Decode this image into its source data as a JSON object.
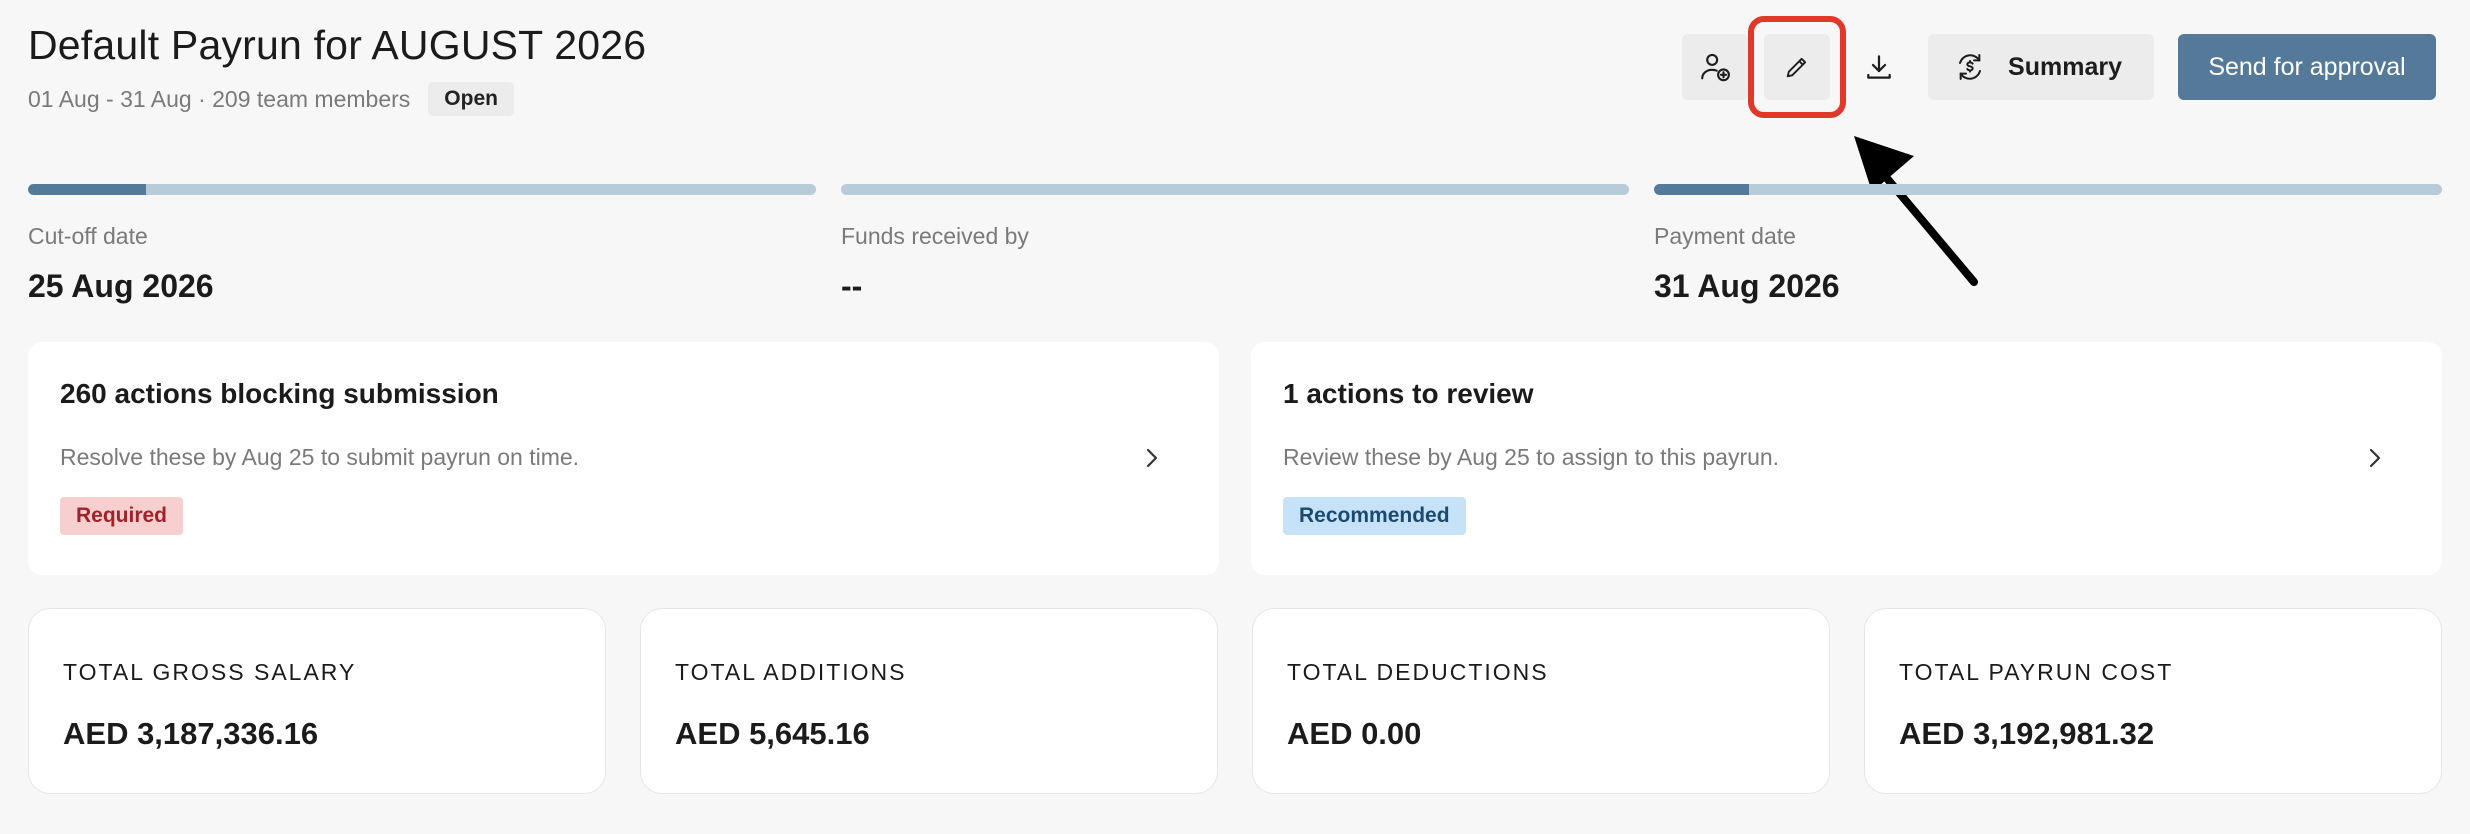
{
  "header": {
    "title": "Default Payrun for AUGUST 2026",
    "subtitle": "01 Aug - 31 Aug · 209 team members",
    "status": "Open"
  },
  "toolbar": {
    "add_member_icon": "user-add-icon",
    "edit_icon": "pencil-icon",
    "download_icon": "download-icon",
    "summary_label": "Summary",
    "summary_icon": "refresh-dollar-icon",
    "approval_label": "Send for approval"
  },
  "timeline": [
    {
      "label": "Cut-off date",
      "value": "25 Aug 2026",
      "progress": 0.15
    },
    {
      "label": "Funds received by",
      "value": "--",
      "progress": 0
    },
    {
      "label": "Payment date",
      "value": "31 Aug 2026",
      "progress": 0.12
    }
  ],
  "actions": [
    {
      "title": "260 actions blocking submission",
      "description": "Resolve these by Aug 25 to submit payrun on time.",
      "tag": "Required"
    },
    {
      "title": "1 actions to review",
      "description": "Review these by Aug 25 to assign to this payrun.",
      "tag": "Recommended"
    }
  ],
  "totals": [
    {
      "label": "TOTAL GROSS SALARY",
      "value": "AED 3,187,336.16"
    },
    {
      "label": "TOTAL ADDITIONS",
      "value": "AED 5,645.16"
    },
    {
      "label": "TOTAL DEDUCTIONS",
      "value": "AED 0.00"
    },
    {
      "label": "TOTAL PAYRUN COST",
      "value": "AED 3,192,981.32"
    }
  ],
  "colors": {
    "accent": "#557a99",
    "track": "#b7cbd9",
    "highlight": "#e0382a",
    "required_bg": "#f8cfcf",
    "recommended_bg": "#c6e2f8"
  }
}
